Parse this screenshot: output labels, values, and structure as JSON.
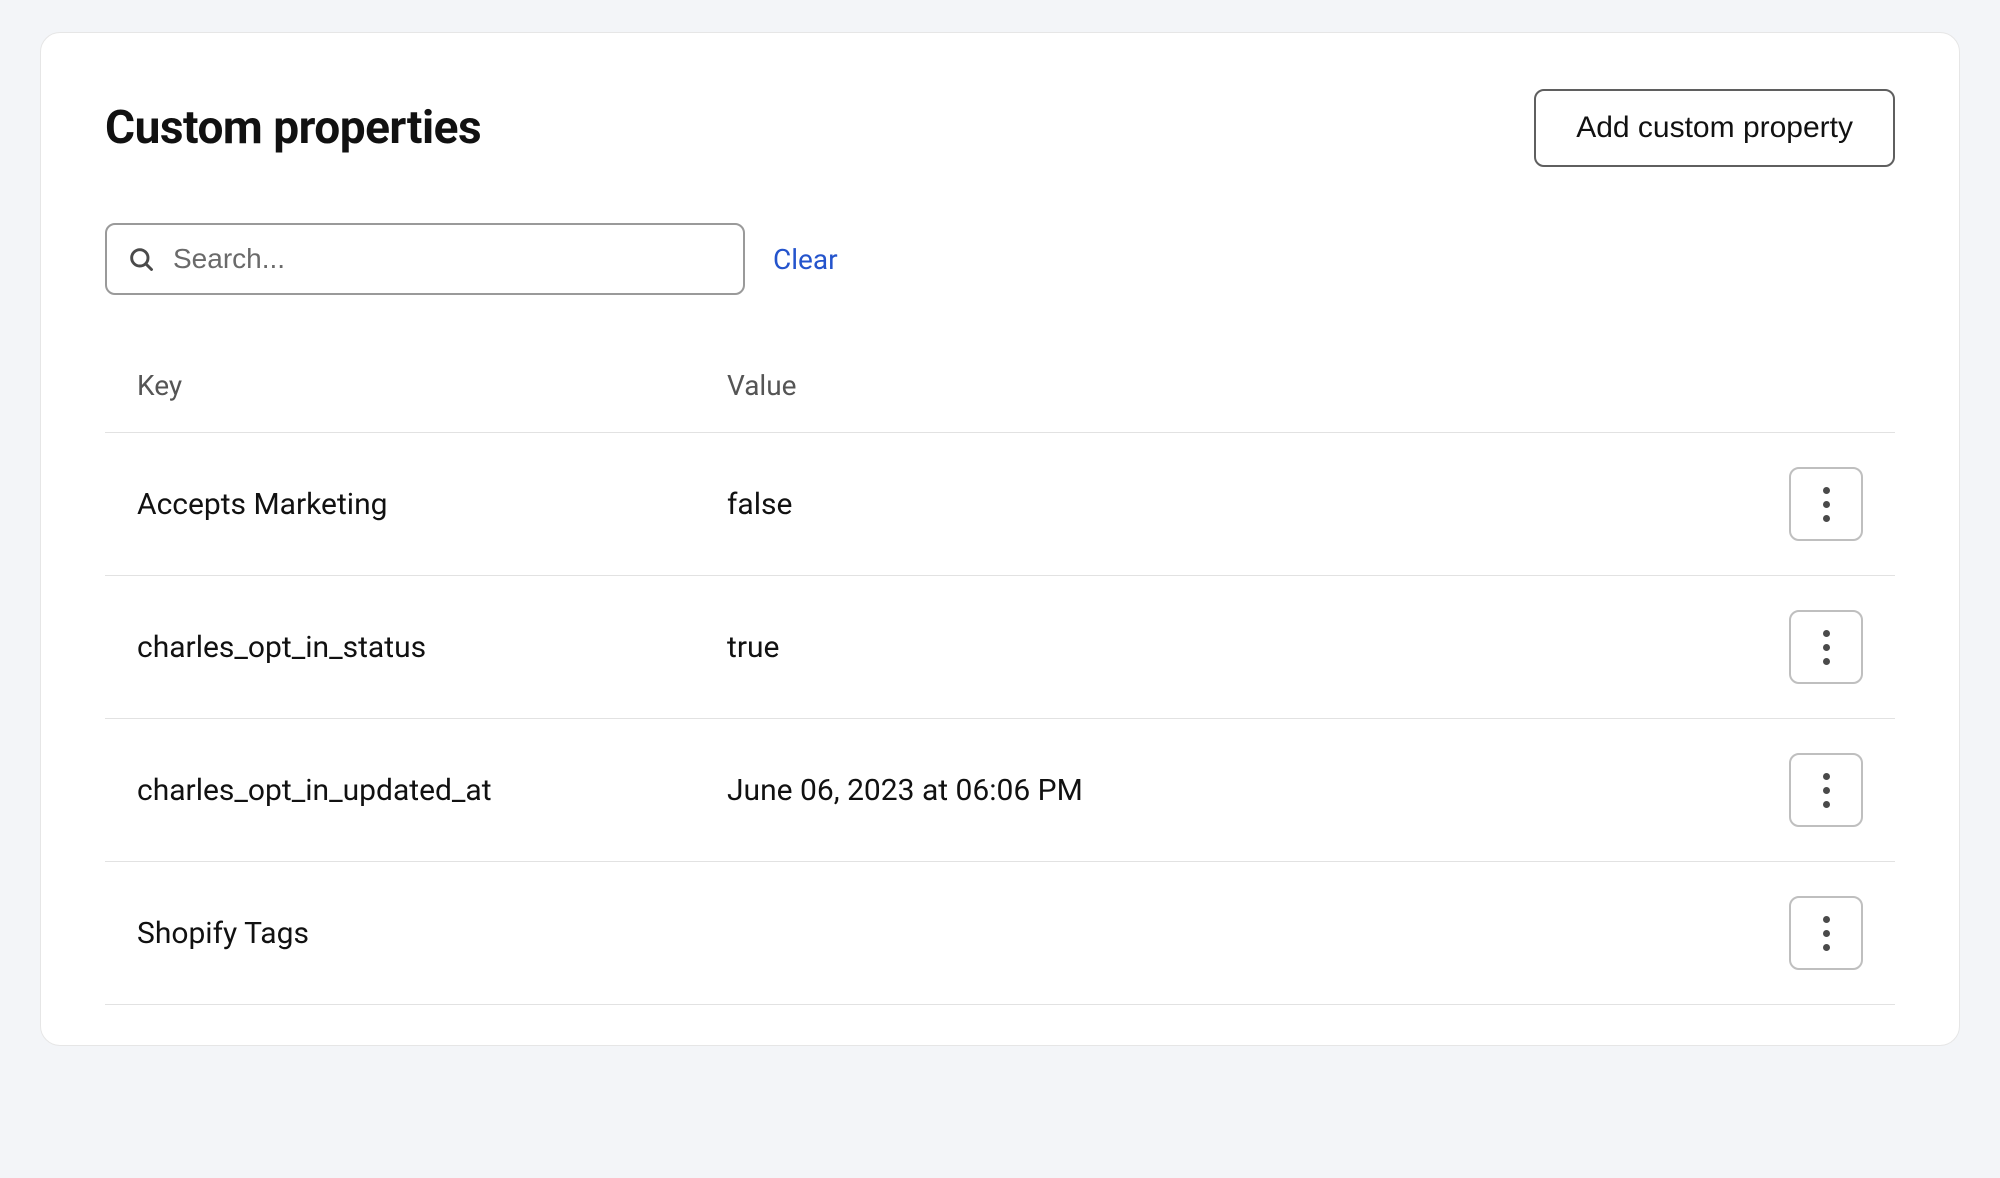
{
  "header": {
    "title": "Custom properties",
    "add_button_label": "Add custom property"
  },
  "search": {
    "placeholder": "Search...",
    "value": "",
    "clear_label": "Clear"
  },
  "table": {
    "columns": {
      "key": "Key",
      "value": "Value"
    },
    "rows": [
      {
        "key": "Accepts Marketing",
        "value": "false"
      },
      {
        "key": "charles_opt_in_status",
        "value": "true"
      },
      {
        "key": "charles_opt_in_updated_at",
        "value": "June 06, 2023 at 06:06 PM"
      },
      {
        "key": "Shopify Tags",
        "value": ""
      }
    ]
  }
}
